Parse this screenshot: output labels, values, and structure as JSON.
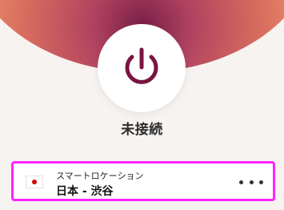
{
  "status": {
    "label": "未接続"
  },
  "power_button": {
    "icon": "power-icon",
    "accent_color": "#7a1542"
  },
  "location": {
    "type_label": "スマートロケーション",
    "name": "日本 - 渋谷",
    "flag": "japan-flag",
    "menu_icon": "more-horizontal-icon"
  },
  "colors": {
    "glow_inner": "#7a1f48",
    "glow_outer": "#f8bd7a",
    "selection_outline": "#ff24ff"
  }
}
